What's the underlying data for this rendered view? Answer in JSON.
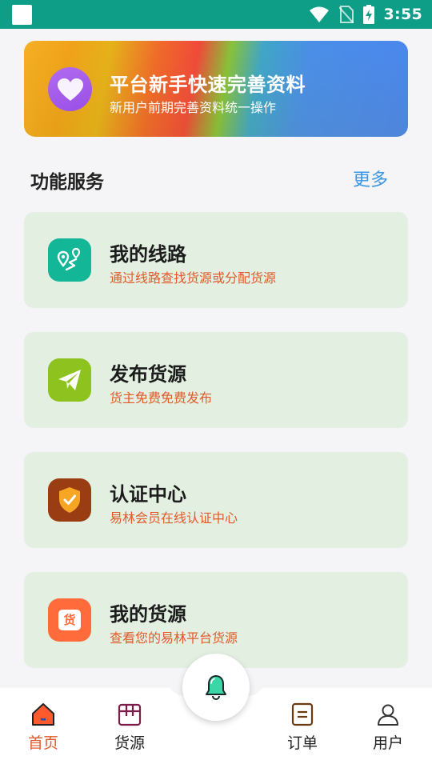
{
  "banner": {
    "title": "平台新手快速完善资料",
    "subtitle": "新用户前期完善资料统一操作"
  },
  "section": {
    "title": "功能服务",
    "more": "更多"
  },
  "cards": [
    {
      "title": "我的线路",
      "subtitle": "通过线路查找货源或分配货源",
      "icon": "route-map-icon",
      "color": "#13b798"
    },
    {
      "title": "发布货源",
      "subtitle": "货主免费免费发布",
      "icon": "paper-plane-icon",
      "color": "#8dc21f"
    },
    {
      "title": "认证中心",
      "subtitle": "易林会员在线认证中心",
      "icon": "shield-check-icon",
      "color": "#9a3d12"
    },
    {
      "title": "我的货源",
      "subtitle": "查看您的易林平台货源",
      "icon": "cargo-icon",
      "color": "#ff6b3a",
      "icon_text": "货"
    }
  ],
  "nav": {
    "items": [
      {
        "label": "首页",
        "icon": "home-icon",
        "active": true
      },
      {
        "label": "货源",
        "icon": "box-icon",
        "active": false
      },
      {
        "label": "订单",
        "icon": "order-icon",
        "active": false
      },
      {
        "label": "用户",
        "icon": "user-icon",
        "active": false
      }
    ],
    "fab_icon": "bell-icon"
  },
  "status_bar": {
    "time": "3:55"
  }
}
